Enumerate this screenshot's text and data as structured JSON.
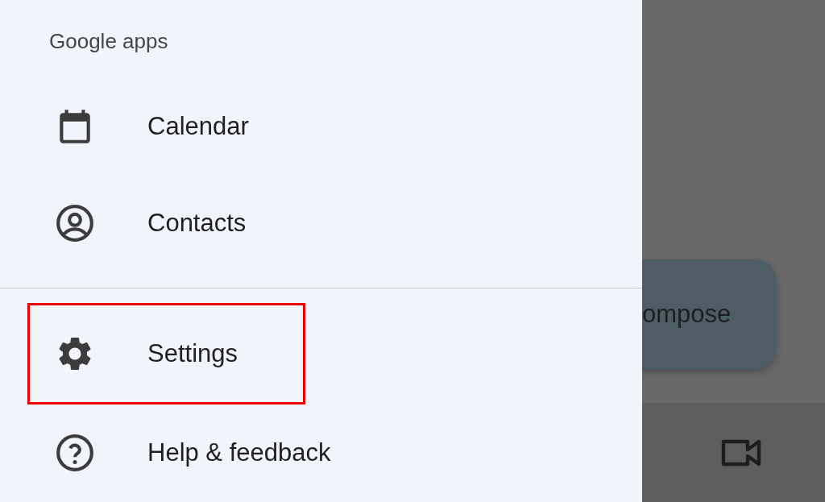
{
  "drawer": {
    "section_title": "Google apps",
    "items": [
      {
        "kind": "calendar",
        "label": "Calendar",
        "highlighted": false
      },
      {
        "kind": "contacts",
        "label": "Contacts",
        "highlighted": false
      },
      {
        "kind": "divider"
      },
      {
        "kind": "settings",
        "label": "Settings",
        "highlighted": true
      },
      {
        "kind": "help",
        "label": "Help & feedback",
        "highlighted": false
      }
    ]
  },
  "background": {
    "compose_button": "ompose"
  }
}
